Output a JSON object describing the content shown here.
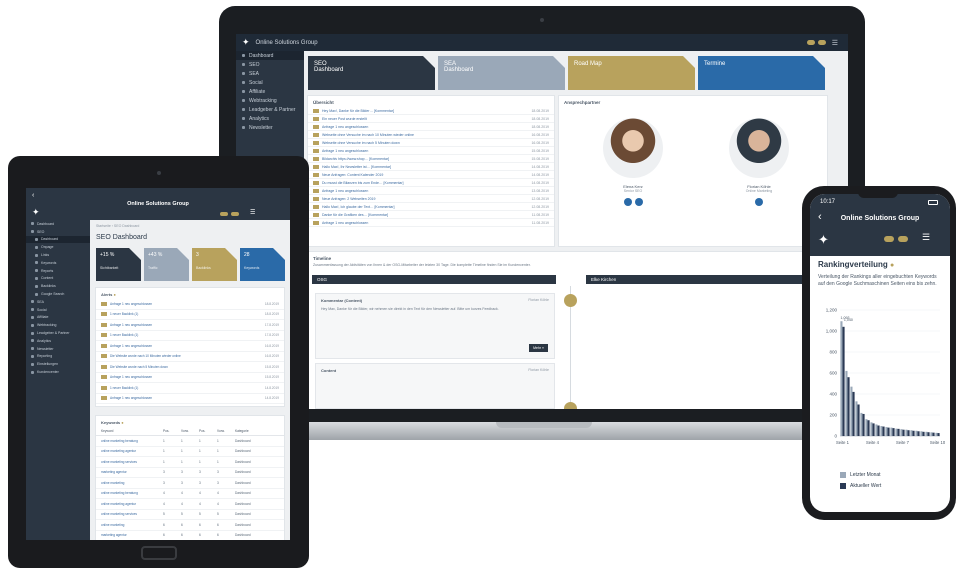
{
  "brand": {
    "app_name": "Online Solutions Group",
    "accent_gold": "#b8a25d",
    "navy": "#2b3643",
    "blue": "#2a6aa8",
    "grey_blue": "#9aa8b8"
  },
  "laptop": {
    "sidebar": [
      {
        "label": "Dashboard",
        "icon": "home-icon"
      },
      {
        "label": "SEO",
        "icon": "search-icon"
      },
      {
        "label": "SEA",
        "icon": "ad-icon"
      },
      {
        "label": "Social",
        "icon": "share-icon"
      },
      {
        "label": "Affiliate",
        "icon": "link-icon"
      },
      {
        "label": "Webtracking",
        "icon": "chart-icon"
      },
      {
        "label": "Leadgeber & Partner",
        "icon": "users-icon"
      },
      {
        "label": "Analytics",
        "icon": "analytics-icon"
      },
      {
        "label": "Newsletter",
        "icon": "mail-icon"
      }
    ],
    "tiles": [
      {
        "line1": "SEO",
        "line2": "Dashboard",
        "color": "#2b3643"
      },
      {
        "line1": "SEA",
        "line2": "Dashboard",
        "color": "#9aa8b8"
      },
      {
        "line1": "Road Map",
        "line2": "",
        "color": "#b8a25d"
      },
      {
        "line1": "Termine",
        "line2": "",
        "color": "#2a6aa8"
      }
    ],
    "news_title": "Übersicht",
    "news": [
      {
        "text": "Hey Max!, Danke für die Bilder… [Kommentar]",
        "date": "18.08.2019"
      },
      {
        "text": "Ein neuer Post wurde erstellt",
        "date": "18.08.2019"
      },
      {
        "text": "Anfrage 1 neu angeschlossen",
        "date": "18.08.2019"
      },
      {
        "text": "Webseite ohne Versuche im nach 10 Minuten wieder online",
        "date": "16.08.2019"
      },
      {
        "text": "Webseite ohne Versuche im nach 5 Minuten down",
        "date": "16.08.2019"
      },
      {
        "text": "Anfrage 1 neu angeschlossen",
        "date": "15.08.2019"
      },
      {
        "text": "Bildarchiv https://www.shop… [Kommentar]",
        "date": "15.08.2019"
      },
      {
        "text": "Hallo Max!, Ihr Newsletter ist… [Kommentar]",
        "date": "14.08.2019"
      },
      {
        "text": "Neue Anfragen: Content Kalender 2019",
        "date": "14.08.2019"
      },
      {
        "text": "Du musst die Bilanzen bis zum Ende… [Kommentar]",
        "date": "14.08.2019"
      },
      {
        "text": "Anfrage 1 neu angeschlossen",
        "date": "13.08.2019"
      },
      {
        "text": "Neue Anfragen: 2 Webseiten 2019",
        "date": "12.08.2019"
      },
      {
        "text": "Hallo Max!, Ich glaube der Text… [Kommentar]",
        "date": "12.08.2019"
      },
      {
        "text": "Danke für die Grafiken des… [Kommentar]",
        "date": "11.08.2019"
      },
      {
        "text": "Anfrage 1 neu angeschlossen",
        "date": "11.08.2019"
      }
    ],
    "contacts_title": "Ansprechpartner",
    "contacts": [
      {
        "name": "Elena Kerz",
        "role": "Senior SEO"
      },
      {
        "name": "Florian Köhle",
        "role": "Online Marketing"
      }
    ],
    "timeline_title": "Timeline",
    "timeline_desc": "Zusammenfassung der Aktivitäten von Ihnen & der OSG-Mitarbeiter der letzten 30 Tage. Die komplette Timeline finden Sie im Kundencenter.",
    "timeline_left_head": "OSG",
    "timeline_right_head": "Elke Kirchen",
    "timeline_item_title": "Kommentar (Content)",
    "timeline_item_author": "Florian Köhle",
    "timeline_item_text": "Hey Max, Danke für die Bilder, wir nehmen sie direkt in den Text für den Newsletter auf. Bitte um kurzes Feedback.",
    "timeline_more": "Mehr »",
    "timeline_item2_title": "Content"
  },
  "tablet": {
    "sidebar": [
      "Dashboard",
      "SEO",
      "Dashboard",
      "Onpage",
      "Links",
      "Keywords",
      "Reports",
      "Content",
      "Backlinks",
      "Google Search",
      "SEA",
      "Social",
      "Affiliate",
      "Webtracking",
      "Leadgeber & Partner",
      "Analytics",
      "Newsletter",
      "Reporting",
      "Einstellungen",
      "Kundencenter"
    ],
    "breadcrumb": "Startseite › SEO Dashboard",
    "page_title": "SEO Dashboard",
    "tiles": [
      {
        "value": "+15 %",
        "label": "Sichtbarkeit",
        "color": "#2b3643"
      },
      {
        "value": "+43 %",
        "label": "Traffic",
        "color": "#9aa8b8"
      },
      {
        "value": "3",
        "label": "Backlinks",
        "color": "#b8a25d"
      },
      {
        "value": "28",
        "label": "Keywords",
        "color": "#2a6aa8"
      }
    ],
    "news_title": "Alerts",
    "news": [
      {
        "text": "Anfrage 1 neu angeschlossen",
        "date": "18.8.2019"
      },
      {
        "text": "1 neuer Backlink (1)",
        "date": "18.8.2019"
      },
      {
        "text": "Anfrage 1 neu angeschlossen",
        "date": "17.8.2019"
      },
      {
        "text": "1 neuer Backlink (1)",
        "date": "17.8.2019"
      },
      {
        "text": "Anfrage 1 neu angeschlossen",
        "date": "16.8.2019"
      },
      {
        "text": "Die Website wurde nach 10 Minuten wieder online",
        "date": "16.8.2019"
      },
      {
        "text": "Die Website wurde nach 5 Minuten down",
        "date": "15.8.2019"
      },
      {
        "text": "Anfrage 1 neu angeschlossen",
        "date": "15.8.2019"
      },
      {
        "text": "1 neuer Backlink (1)",
        "date": "14.8.2019"
      },
      {
        "text": "Anfrage 1 neu angeschlossen",
        "date": "14.8.2019"
      }
    ],
    "kw_title": "Keywords",
    "kw_headers": [
      "Keyword",
      "Pos.",
      "Vorw.",
      "Pos.",
      "Vorw.",
      "Kategorie"
    ],
    "kw_rows": [
      [
        "online marketing beratung",
        "1",
        "1",
        "1",
        "1",
        "Dashboard"
      ],
      [
        "online marketing agentur",
        "1",
        "1",
        "1",
        "1",
        "Dashboard"
      ],
      [
        "online marketing services",
        "1",
        "1",
        "1",
        "1",
        "Dashboard"
      ],
      [
        "marketing agentur",
        "3",
        "3",
        "3",
        "3",
        "Dashboard"
      ],
      [
        "online marketing",
        "3",
        "3",
        "3",
        "3",
        "Dashboard"
      ],
      [
        "online marketing beratung",
        "4",
        "4",
        "4",
        "4",
        "Dashboard"
      ],
      [
        "online marketing agentur",
        "4",
        "4",
        "4",
        "4",
        "Dashboard"
      ],
      [
        "online marketing services",
        "5",
        "5",
        "5",
        "5",
        "Dashboard"
      ],
      [
        "online marketing",
        "6",
        "6",
        "6",
        "6",
        "Dashboard"
      ],
      [
        "marketing agentur",
        "6",
        "6",
        "6",
        "6",
        "Dashboard"
      ]
    ]
  },
  "phone": {
    "time": "10:17",
    "header_title": "Online Solutions Group",
    "chart_title": "Rankingverteilung",
    "chart_desc": "Verteilung der Rankings aller eingebuchten Keywords auf den Google Suchmaschinen Seiten eins bis zehn.",
    "legend": [
      {
        "label": "Letzter Monat",
        "color": "#9aa8b8"
      },
      {
        "label": "Aktueller Wert",
        "color": "#2b3a55"
      }
    ]
  },
  "chart_data": {
    "type": "bar",
    "title": "Rankingverteilung",
    "ylim": [
      0,
      1200
    ],
    "yticks": [
      0,
      200,
      400,
      600,
      800,
      1000,
      1200
    ],
    "xticks": [
      "Seite 1",
      "Seite 4",
      "Seite 7",
      "Seite 10"
    ],
    "data_labels": [
      "1,093",
      "1,040"
    ],
    "series": [
      {
        "name": "Letzter Monat",
        "color": "#9aa8b8",
        "values": [
          1093,
          620,
          470,
          330,
          220,
          160,
          130,
          110,
          95,
          85,
          80,
          70,
          65,
          60,
          55,
          50,
          45,
          40,
          35,
          30
        ]
      },
      {
        "name": "Aktueller Wert",
        "color": "#2b3a55",
        "values": [
          1040,
          560,
          420,
          300,
          210,
          150,
          120,
          100,
          90,
          80,
          75,
          68,
          60,
          55,
          50,
          45,
          40,
          36,
          32,
          28
        ]
      }
    ]
  }
}
